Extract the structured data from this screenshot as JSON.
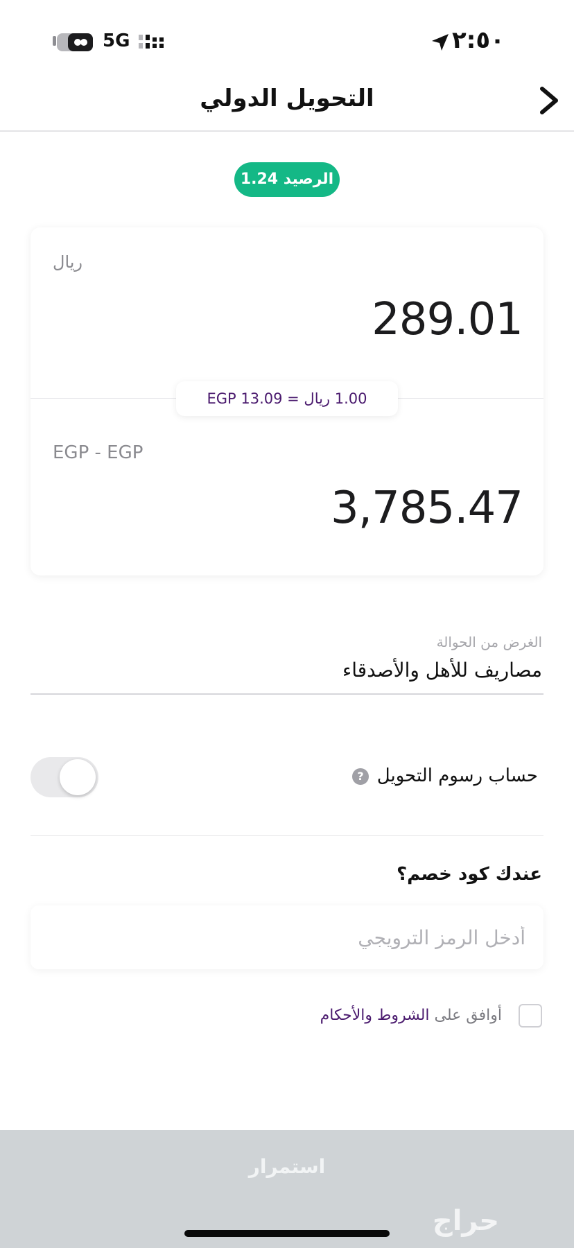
{
  "status_bar": {
    "time": "٢:٥٠",
    "network": "5G",
    "battery_icon": "battery-icon",
    "signal_icon": "signal-bars-icon",
    "location_icon": "location-arrow-icon"
  },
  "header": {
    "title": "التحويل الدولي",
    "back_icon": "chevron-right-icon"
  },
  "balance": {
    "label": "الرصيد 1.24"
  },
  "send": {
    "currency": "ريال",
    "amount": "289.01"
  },
  "exchange": {
    "rate_text": "1.00 ريال = EGP 13.09"
  },
  "receive": {
    "currency": "EGP - EGP",
    "amount": "3,785.47"
  },
  "purpose": {
    "label": "الغرض من الحوالة",
    "value": "مصاريف للأهل والأصدقاء"
  },
  "fees": {
    "label": "حساب رسوم التحويل",
    "help_icon": "question-circle-icon",
    "toggle_on": false
  },
  "promo": {
    "question": "عندك كود خصم؟",
    "placeholder": "أدخل الرمز الترويجي",
    "value": ""
  },
  "terms": {
    "prefix": "أوافق على ",
    "link": "الشروط والأحكام",
    "checked": false
  },
  "continue_button": {
    "label": "استمرار"
  },
  "watermark": "حراج",
  "colors": {
    "accent_green": "#14b886",
    "accent_purple": "#4a1a6e",
    "disabled_button": "#cfd3d6"
  }
}
